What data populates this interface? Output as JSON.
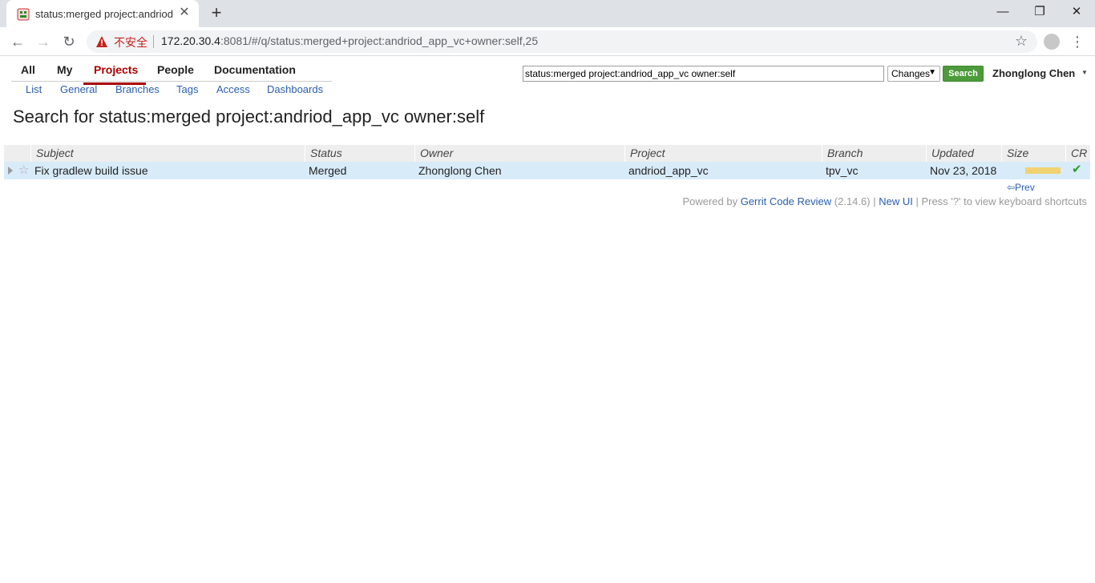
{
  "browser": {
    "tab_title": "status:merged project:andriod",
    "url_warning": "不安全",
    "url_host": "172.20.30.4",
    "url_rest": ":8081/#/q/status:merged+project:andriod_app_vc+owner:self,25"
  },
  "menu": {
    "all": "All",
    "my": "My",
    "projects": "Projects",
    "people": "People",
    "documentation": "Documentation"
  },
  "submenu": {
    "list": "List",
    "general": "General",
    "branches": "Branches",
    "tags": "Tags",
    "access": "Access",
    "dashboards": "Dashboards"
  },
  "search": {
    "query": "status:merged project:andriod_app_vc owner:self",
    "type": "Changes",
    "button": "Search"
  },
  "user": "Zhonglong Chen",
  "page_title": "Search for status:merged project:andriod_app_vc owner:self",
  "table": {
    "headers": [
      "Subject",
      "Status",
      "Owner",
      "Project",
      "Branch",
      "Updated",
      "Size",
      "CR"
    ],
    "rows": [
      {
        "subject": "Fix gradlew build issue",
        "status": "Merged",
        "owner": "Zhonglong Chen",
        "project": "andriod_app_vc",
        "branch": "tpv_vc",
        "updated": "Nov 23, 2018",
        "cr": "✔"
      }
    ]
  },
  "pagination": {
    "prev": "⇦Prev"
  },
  "footer": {
    "powered_by": "Powered by",
    "gerrit_link": "Gerrit Code Review",
    "version": "(2.14.6) |",
    "new_ui": "New UI",
    "shortcuts": "| Press '?' to view keyboard shortcuts"
  },
  "colors": {
    "accent": "#aa0000",
    "link": "#2a5db0",
    "search_button": "#4d9a3b",
    "row_highlight": "#d8ebf9",
    "size_bar": "#f0d371"
  }
}
